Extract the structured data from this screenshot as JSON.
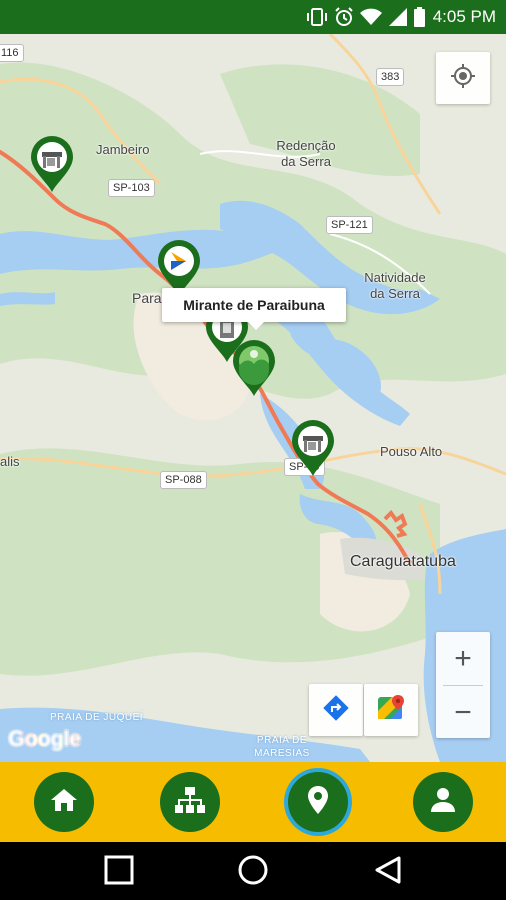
{
  "status_bar": {
    "time": "4:05 PM",
    "icons": [
      "vibrate-icon",
      "alarm-icon",
      "wifi-icon",
      "cellular-icon",
      "battery-icon"
    ]
  },
  "map": {
    "places": {
      "jambeiro": "Jambeiro",
      "redencao": "Redenção\nda Serra",
      "natividade": "Natividade\nda Serra",
      "paraibuna": "Parai",
      "pouso_alto": "Pouso Alto",
      "caraguatatuba": "Caraguatatuba",
      "alis": "alis",
      "praia_juquei": "PRAIA DE JUQUEÍ",
      "praia_maresias": "PRAIA DE\nMARESIAS"
    },
    "roads": {
      "r116": "116",
      "r383": "383",
      "sp103": "SP-103",
      "sp121": "SP-121",
      "sp088": "SP-088",
      "sp99": "SP-99"
    },
    "tooltip": "Mirante de Paraibuna",
    "google_logo": "Google",
    "zoom_in": "+",
    "zoom_out": "−",
    "colors": {
      "route": "#f07a55",
      "pin": "#1b6e1b",
      "water": "#a6cdf2",
      "land": "#e8eadf",
      "forest": "#cfe3c3"
    }
  },
  "bottom_nav": {
    "items": [
      "home-icon",
      "sitemap-icon",
      "map-marker-icon",
      "user-icon"
    ],
    "active": "map-marker-icon",
    "background": "#f6bd00",
    "button_color": "#1b6e1b",
    "active_ring": "#2ea8d8"
  },
  "system_nav": [
    "recents-icon",
    "home-circle-icon",
    "back-icon"
  ]
}
